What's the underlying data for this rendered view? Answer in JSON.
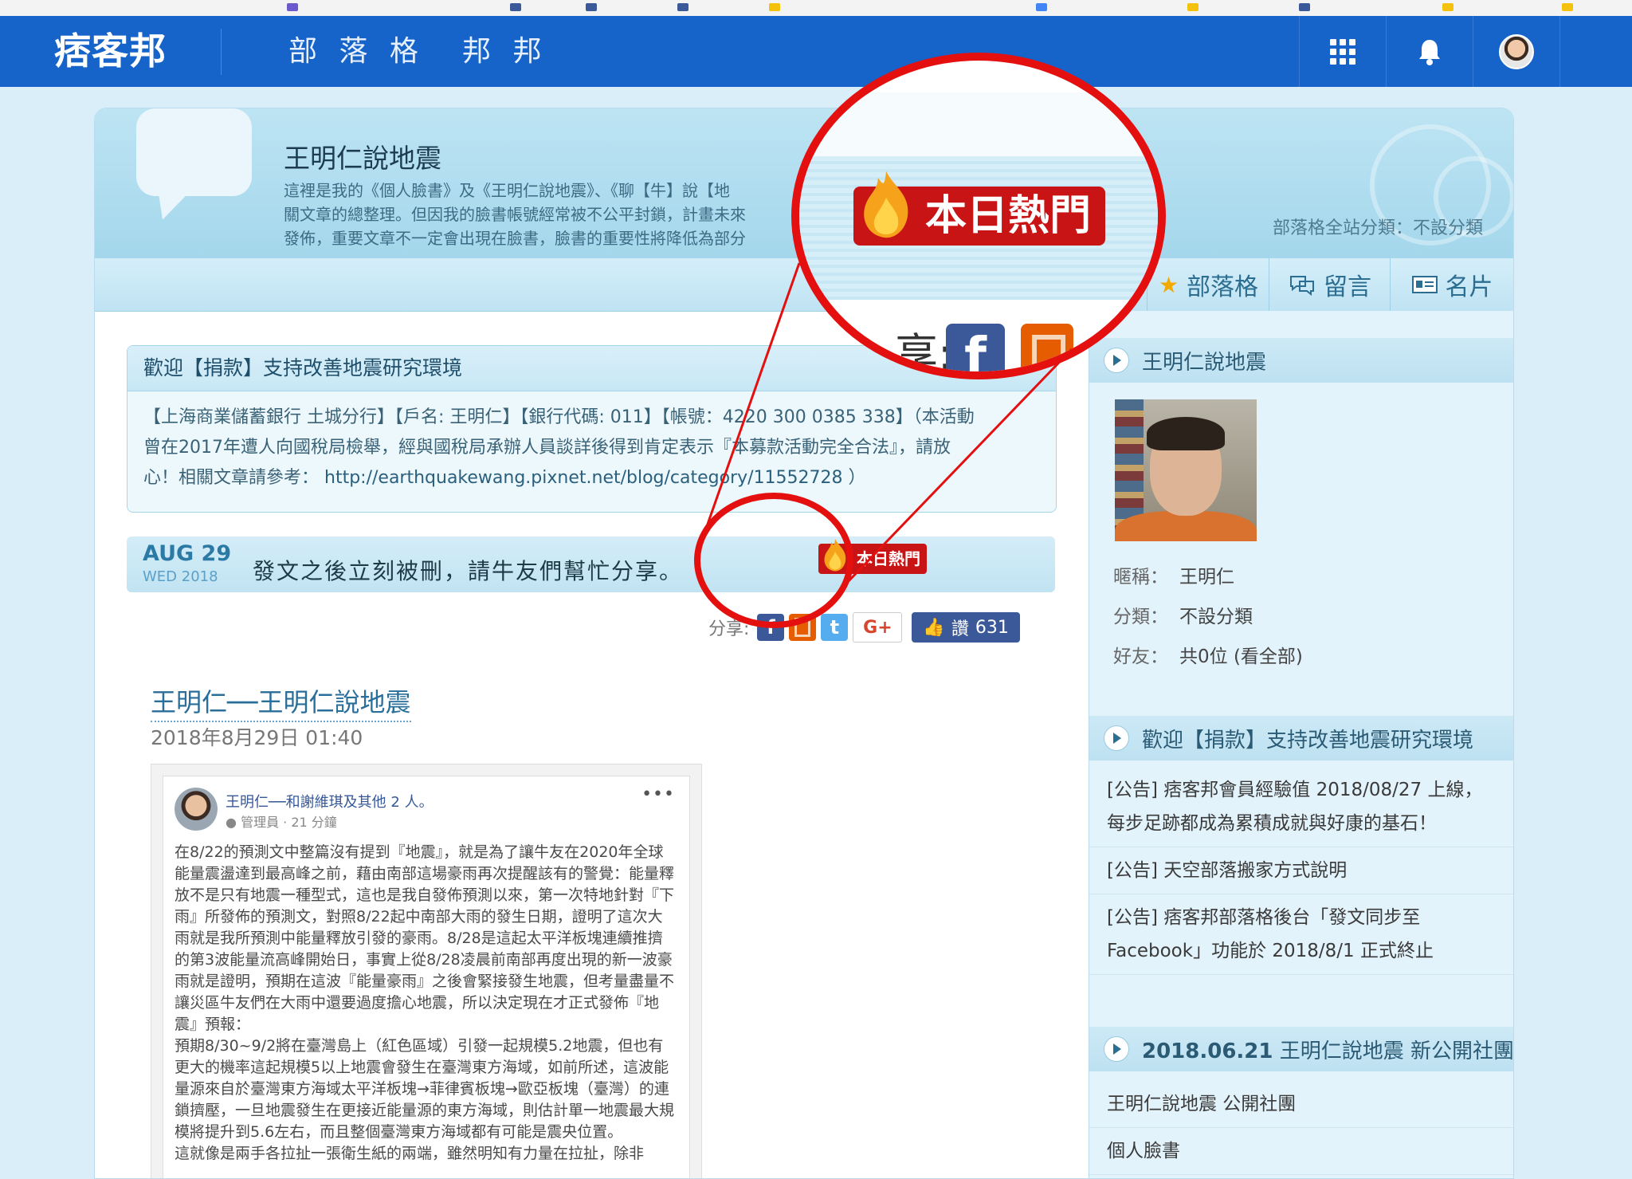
{
  "topbar": {
    "logo": "痞客邦",
    "nav": [
      "部 落 格",
      "邦 邦"
    ],
    "icons": [
      "apps-icon",
      "bell-icon",
      "avatar"
    ]
  },
  "blog": {
    "title": "王明仁說地震",
    "description": "這裡是我的《個人臉書》及《王明仁說地震》、《聊【牛】說【地",
    "description_line2": "關文章的總整理。但因我的臉書帳號經常被不公平封鎖，計畫未來",
    "description_line3": "發佈，重要文章不一定會出現在臉書，臉書的重要性將降低為部分",
    "category": "部落格全站分類：不設分類",
    "tabs": [
      "部落格",
      "留言",
      "名片"
    ]
  },
  "notice": {
    "title": "歡迎【捐款】支持改善地震研究環境",
    "body_line1": "【上海商業儲蓄銀行 土城分行】【戶名: 王明仁】【銀行代碼: 011】【帳號：4220 300 0385 338】（本活動",
    "body_line2": "曾在2017年遭人向國稅局檢舉，經與國稅局承辦人員談詳後得到肯定表示『本募款活動完全合法』，請放",
    "body_line3_prefix": "心！相關文章請參考：",
    "url": "http://earthquakewang.pixnet.net/blog/category/11552728",
    "body_line3_suffix": "）"
  },
  "post_header": {
    "month_day": "AUG 29",
    "weekday_year": "WED 2018",
    "text": "發文之後立刻被刪，請牛友們幫忙分享。",
    "hot_badge": "本日熱門"
  },
  "share": {
    "label": "分享:",
    "gplus": "G+",
    "like_label": "讚",
    "like_count": "631"
  },
  "post": {
    "title": "王明仁──王明仁說地震",
    "date": "2018年8月29日 01:40"
  },
  "fb_post": {
    "author": "王明仁──和謝維琪及其他 2 人。",
    "meta": "管理員 · 21 分鐘",
    "dots": "•••",
    "paragraphs": [
      "在8/22的預測文中整篇沒有提到『地震』，就是為了讓牛友在2020年全球能量震盪達到最高峰之前，藉由南部這場豪雨再次提醒該有的警覺：能量釋放不是只有地震一種型式，這也是我自發佈預測以來，第一次特地針對『下雨』所發佈的預測文，對照8/22起中南部大雨的發生日期，證明了這次大雨就是我所預測中能量釋放引發的豪雨。8/28是這起太平洋板塊連續推擠的第3波能量流高峰開始日，事實上從8/28凌晨前南部再度出現的新一波豪雨就是證明，預期在這波『能量豪雨』之後會緊接發生地震，但考量盡量不讓災區牛友們在大雨中還要過度擔心地震，所以決定現在才正式發佈『地震』預報：",
      "預期8/30~9/2將在臺灣島上（紅色區域）引發一起規模5.2地震，但也有更大的機率這起規模5以上地震會發生在臺灣東方海域，如前所述，這波能量源來自於臺灣東方海域太平洋板塊→菲律賓板塊→歐亞板塊（臺灣）的連鎖擠壓，一旦地震發生在更接近能量源的東方海域，則估計單一地震最大規模將提升到5.6左右，而且整個臺灣東方海域都有可能是震央位置。",
      "這就像是兩手各拉扯一張衛生紙的兩端，雖然明知有力量在拉扯，除非"
    ]
  },
  "sidebar": {
    "profile_title": "王明仁說地震",
    "nickname_label": "暱稱：",
    "nickname": "王明仁",
    "category_label": "分類：",
    "category": "不設分類",
    "friends_label": "好友：",
    "friends": "共0位 (看全部)",
    "donate_title": "歡迎【捐款】支持改善地震研究環境",
    "announcements": [
      "[公告] 痞客邦會員經驗值 2018/08/27 上線，每步足跡都成為累積成就與好康的基石！",
      "[公告] 天空部落搬家方式說明",
      "[公告] 痞客邦部落格後台「發文同步至 Facebook」功能於 2018/8/1 正式終止"
    ],
    "group_title_date": "2018.06.21",
    "group_title_rest": "王明仁說地震 新公開社團",
    "links": [
      "王明仁說地震 公開社團",
      "個人臉書"
    ]
  },
  "magnifier": {
    "hot_badge": "本日熱門",
    "colon": "享:"
  },
  "colors": {
    "topbar": "#1663c9",
    "hot_red": "#c81414",
    "annotation_red": "#e41010",
    "facebook": "#3b5998"
  }
}
